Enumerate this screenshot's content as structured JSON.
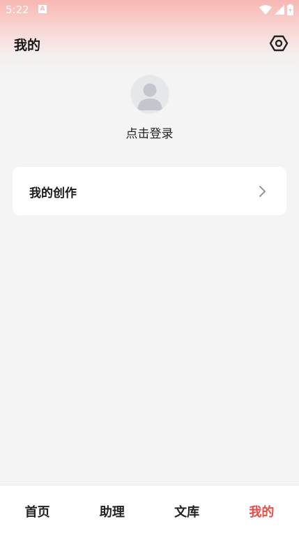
{
  "status_bar": {
    "time": "5:22",
    "notification_icon": "A"
  },
  "header": {
    "title": "我的",
    "settings_icon": "settings-icon"
  },
  "profile": {
    "login_label": "点击登录"
  },
  "menu": {
    "items": [
      {
        "label": "我的创作",
        "icon": "chevron-right-icon"
      }
    ]
  },
  "bottom_nav": {
    "items": [
      {
        "label": "首页"
      },
      {
        "label": "助理"
      },
      {
        "label": "文库"
      },
      {
        "label": "我的"
      }
    ],
    "active_index": 3
  },
  "colors": {
    "accent": "#ef4a44",
    "header_gradient_top": "#f8b7b3",
    "background": "#f4f4f4"
  }
}
